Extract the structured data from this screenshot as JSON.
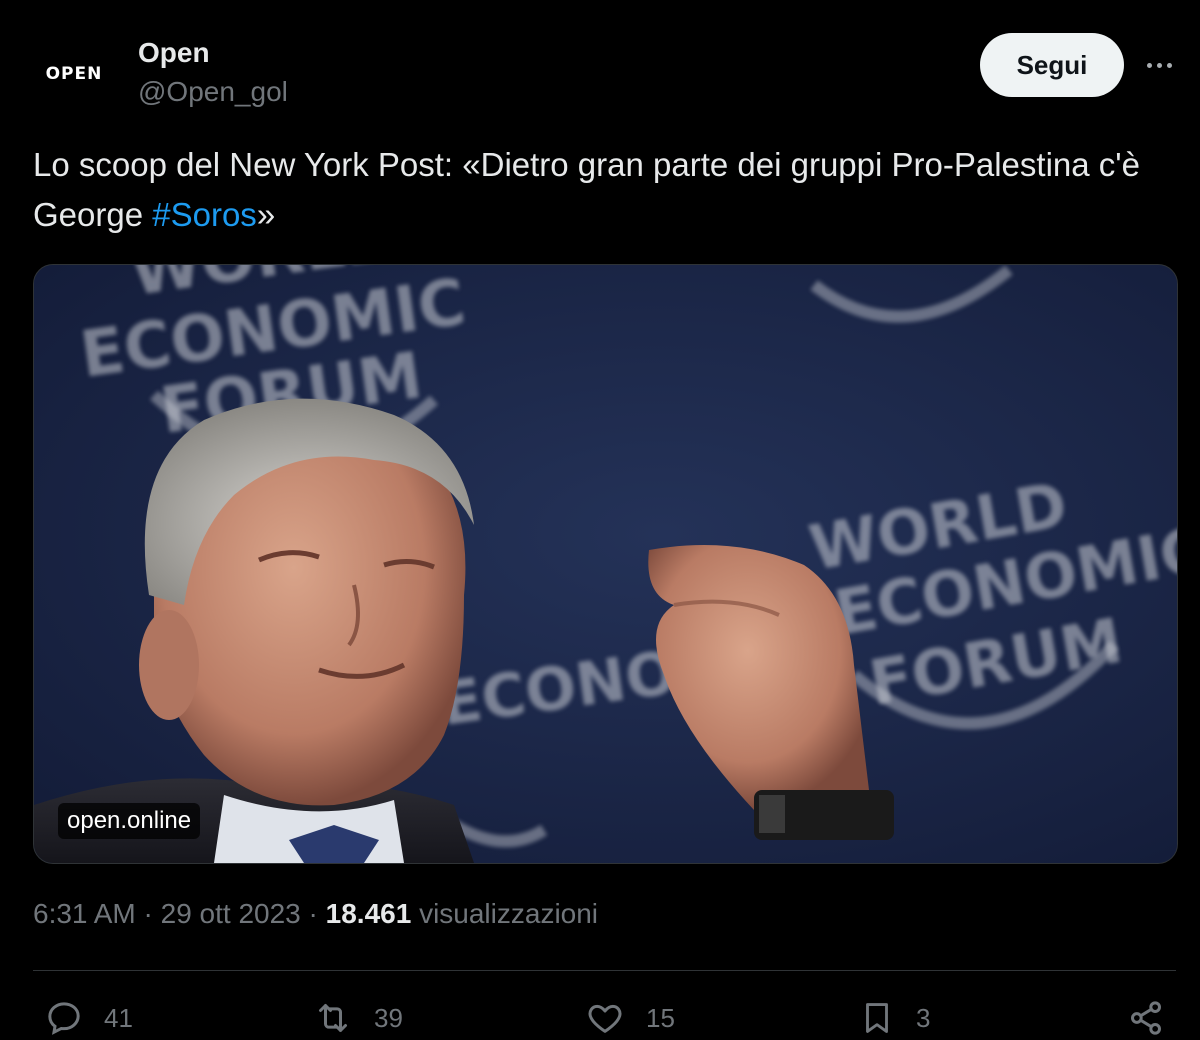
{
  "author": {
    "avatar_text": "OPEN",
    "name": "Open",
    "handle": "@Open_gol"
  },
  "follow_label": "Segui",
  "tweet": {
    "text_before": "Lo scoop del New York Post: «Dietro gran parte dei gruppi Pro-Palestina c'è George ",
    "hashtag": "#Soros",
    "text_after": "»"
  },
  "media": {
    "domain": "open.online",
    "logo_text_lines": [
      "WORLD",
      "ECONOMIC",
      "FORUM"
    ]
  },
  "meta": {
    "time": "6:31 AM",
    "separator": " · ",
    "date": "29 ott 2023",
    "views_count": "18.461",
    "views_label": "visualizzazioni"
  },
  "actions": {
    "reply_count": "41",
    "retweet_count": "39",
    "like_count": "15",
    "bookmark_count": "3"
  },
  "colors": {
    "accent": "#1d9bf0",
    "background": "#000000",
    "secondary_text": "#71767b"
  }
}
